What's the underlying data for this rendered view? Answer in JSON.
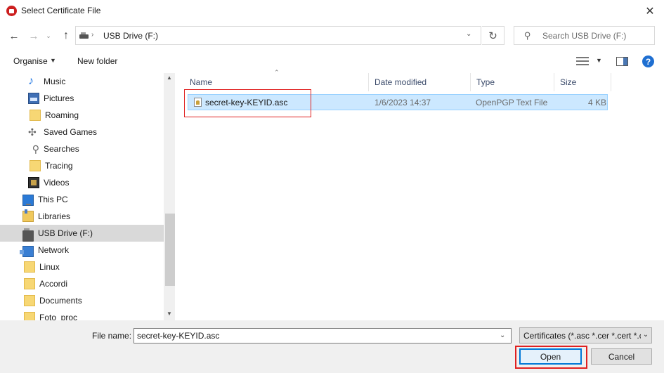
{
  "window": {
    "title": "Select Certificate File"
  },
  "address": {
    "path": "USB Drive (F:)",
    "search_placeholder": "Search USB Drive (F:)"
  },
  "commands": {
    "organise": "Organise",
    "new_folder": "New folder"
  },
  "nav": {
    "items": [
      {
        "label": "Music",
        "icon": "music-icon"
      },
      {
        "label": "Pictures",
        "icon": "pictures-icon"
      },
      {
        "label": "Roaming",
        "icon": "folder-icon"
      },
      {
        "label": "Saved Games",
        "icon": "saved-games-icon"
      },
      {
        "label": "Searches",
        "icon": "searches-icon"
      },
      {
        "label": "Tracing",
        "icon": "folder-icon"
      },
      {
        "label": "Videos",
        "icon": "videos-icon"
      },
      {
        "label": "This PC",
        "icon": "this-pc-icon"
      },
      {
        "label": "Libraries",
        "icon": "libraries-icon"
      },
      {
        "label": "USB Drive (F:)",
        "icon": "usb-drive-icon",
        "selected": true
      },
      {
        "label": "Network",
        "icon": "network-icon"
      },
      {
        "label": "Linux",
        "icon": "folder-icon"
      },
      {
        "label": "Accordi",
        "icon": "folder-icon"
      },
      {
        "label": "Documents",
        "icon": "folder-icon"
      },
      {
        "label": "Foto_proc",
        "icon": "folder-icon"
      }
    ]
  },
  "columns": {
    "name": "Name",
    "date": "Date modified",
    "type": "Type",
    "size": "Size"
  },
  "files": [
    {
      "name": "secret-key-KEYID.asc",
      "date": "1/6/2023 14:37",
      "type": "OpenPGP Text File",
      "size": "4 KB"
    }
  ],
  "footer": {
    "file_name_label": "File name:",
    "file_name_value": "secret-key-KEYID.asc",
    "filter": "Certificates (*.asc *.cer *.cert *.c",
    "open": "Open",
    "cancel": "Cancel"
  }
}
